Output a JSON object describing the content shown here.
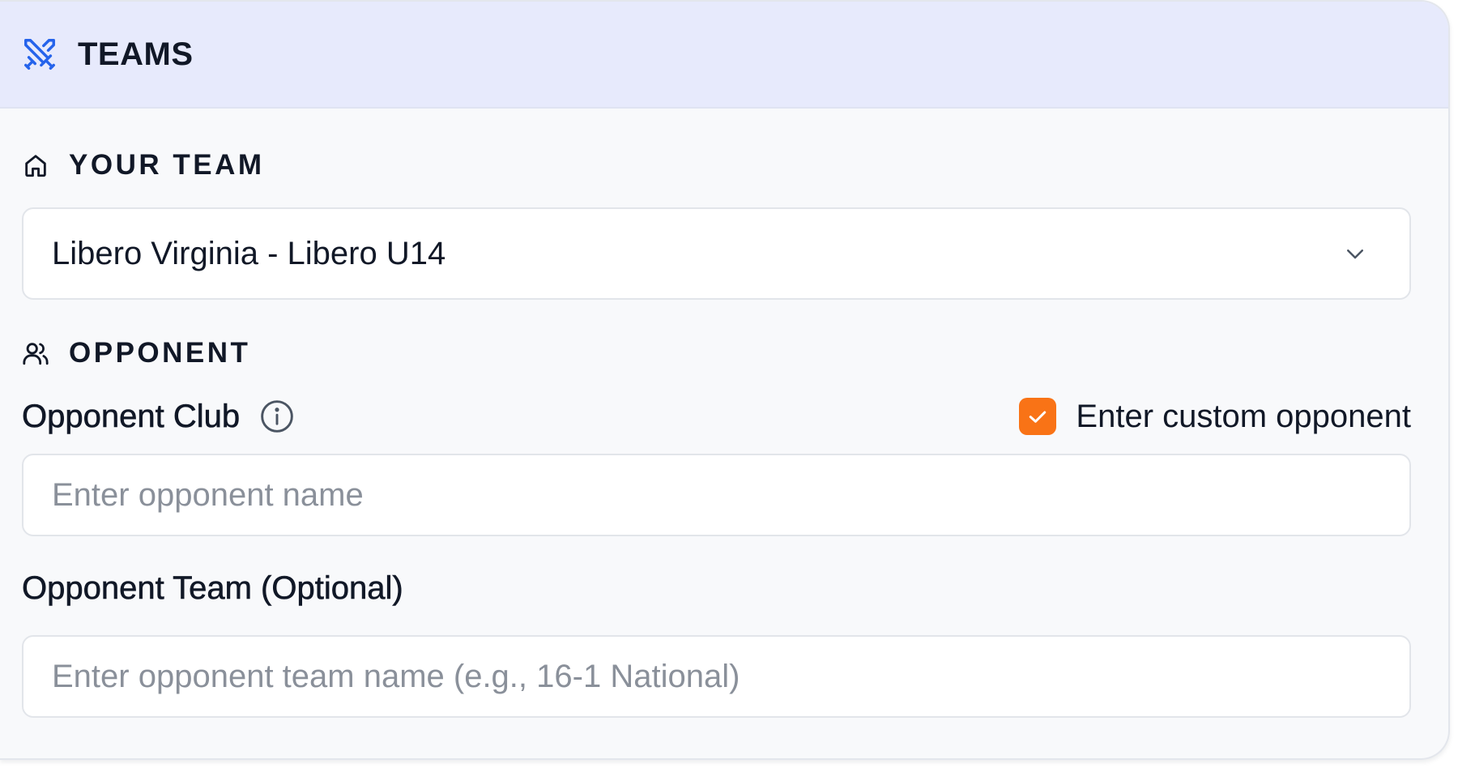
{
  "header": {
    "title": "TEAMS",
    "icon": "crossed-swords-icon",
    "icon_color": "#2563eb",
    "background": "#e7eafc"
  },
  "your_team": {
    "label": "YOUR TEAM",
    "icon": "home-icon",
    "selected_value": "Libero Virginia - Libero U14",
    "dropdown_icon": "chevron-down-icon"
  },
  "opponent": {
    "label": "OPPONENT",
    "icon": "users-icon",
    "club_label": "Opponent Club",
    "club_info_icon": "info-icon",
    "custom_checkbox_label": "Enter custom opponent",
    "custom_checkbox_checked": true,
    "checkbox_color": "#f97316",
    "club_input": {
      "value": "",
      "placeholder": "Enter opponent name"
    },
    "team_label": "Opponent Team (Optional)",
    "team_input": {
      "value": "",
      "placeholder": "Enter opponent team name (e.g., 16-1 National)"
    }
  }
}
